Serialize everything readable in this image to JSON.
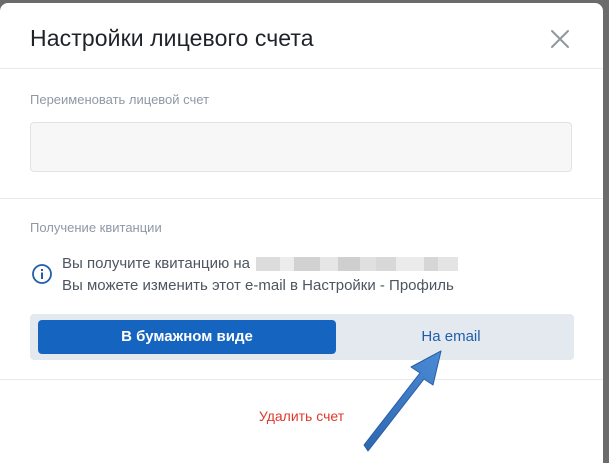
{
  "dialog": {
    "title": "Настройки лицевого счета"
  },
  "rename": {
    "label": "Переименовать лицевой счет",
    "value": "",
    "placeholder": ""
  },
  "receipt": {
    "label": "Получение квитанции",
    "line1_prefix": "Вы получите квитанцию на",
    "line2": "Вы можете изменить этот e-mail в Настройки - Профиль",
    "options": [
      {
        "label": "В бумажном виде",
        "selected": true
      },
      {
        "label": "На email",
        "selected": false
      }
    ]
  },
  "actions": {
    "delete_label": "Удалить счет"
  },
  "colors": {
    "primary": "#1565c0",
    "danger": "#e0382d",
    "annotation_arrow": "#3a77c4"
  }
}
